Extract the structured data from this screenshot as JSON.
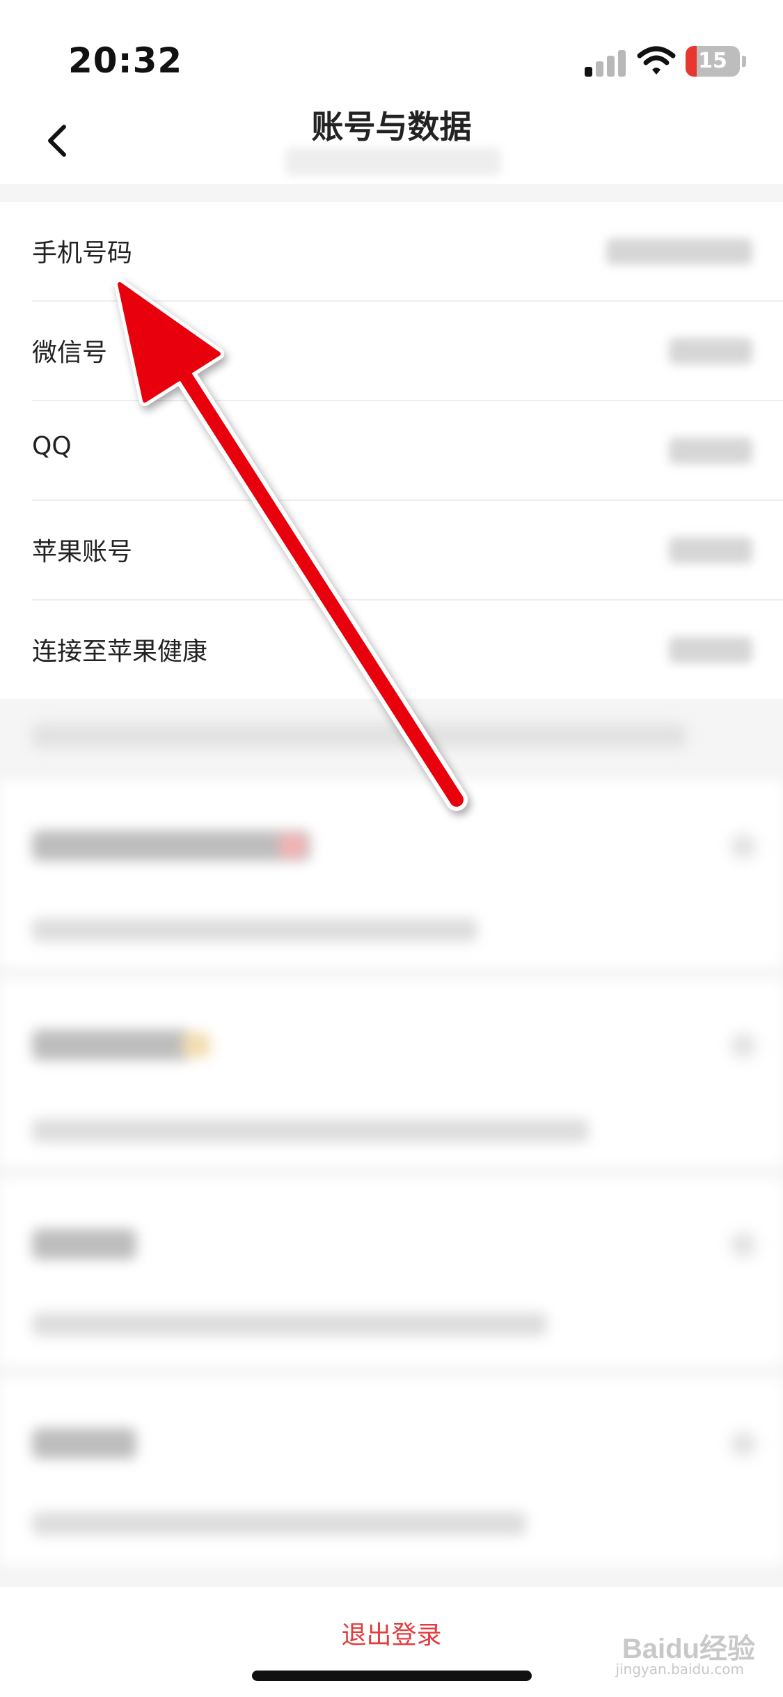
{
  "status_bar": {
    "time": "20:32",
    "battery": "15"
  },
  "nav": {
    "title": "账号与数据",
    "back_icon": "chevron-left-icon"
  },
  "account_rows": [
    {
      "label": "手机号码"
    },
    {
      "label": "微信号"
    },
    {
      "label": "QQ"
    },
    {
      "label": "苹果账号"
    },
    {
      "label": "连接至苹果健康"
    }
  ],
  "footer": {
    "logout_label": "退出登录",
    "watermark": "Baidu经验",
    "watermark_sub": "jingyan.baidu.com"
  },
  "annotation": {
    "type": "red-arrow",
    "points_to": "手机号码",
    "color": "#e8000b"
  }
}
